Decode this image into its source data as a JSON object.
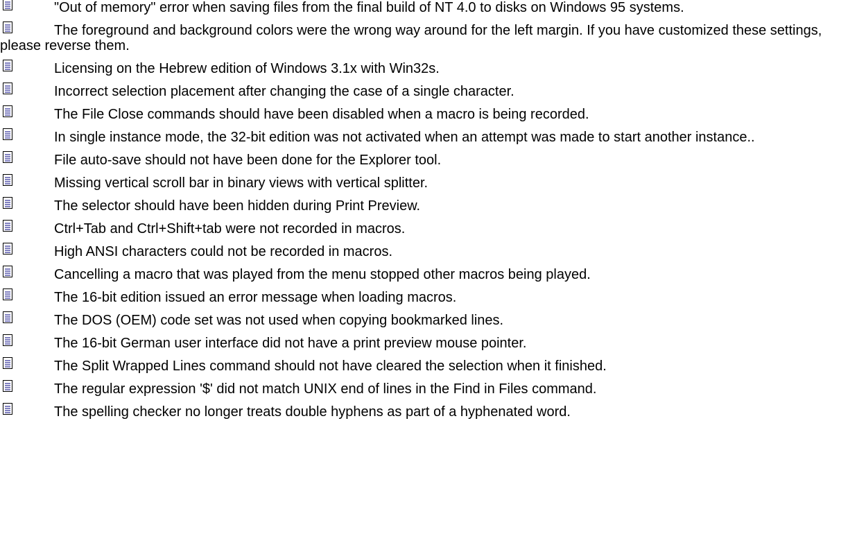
{
  "icon": {
    "name": "document-icon",
    "page_color": "#ffffff",
    "border_color": "#000000",
    "line_color": "#000080"
  },
  "items": [
    {
      "text": "\"Out of memory\" error when saving files from the final build of NT 4.0 to disks on Windows 95 systems."
    },
    {
      "text": "The foreground and background colors were the wrong way around for the left margin.   If you have customized these settings, please reverse them."
    },
    {
      "text": "Licensing on the Hebrew edition of Windows 3.1x with Win32s."
    },
    {
      "text": "Incorrect selection placement after changing the case of a single character."
    },
    {
      "text": "The File Close commands should have been disabled when a macro is being recorded."
    },
    {
      "text": "In single instance mode, the 32-bit edition was not activated when an attempt was made to start another instance.."
    },
    {
      "text": "File auto-save should not have been done for the Explorer tool."
    },
    {
      "text": "Missing vertical scroll bar in binary views with vertical splitter."
    },
    {
      "text": "The selector should have been hidden during Print Preview."
    },
    {
      "text": "Ctrl+Tab and Ctrl+Shift+tab were not recorded in macros."
    },
    {
      "text": "High ANSI characters could not be recorded in macros."
    },
    {
      "text": "Cancelling a macro that was played from the menu stopped other macros being played."
    },
    {
      "text": "The 16-bit edition issued an error message when loading macros."
    },
    {
      "text": "The DOS (OEM) code set was not used when copying bookmarked lines."
    },
    {
      "text": "The 16-bit German user interface did not have a print preview mouse pointer."
    },
    {
      "text": "The Split Wrapped Lines command should not have cleared the selection when it finished."
    },
    {
      "text": "The regular expression '$' did not match UNIX end of lines in the Find in Files command."
    },
    {
      "text": "The spelling checker no longer treats double hyphens as part of a hyphenated word."
    }
  ]
}
